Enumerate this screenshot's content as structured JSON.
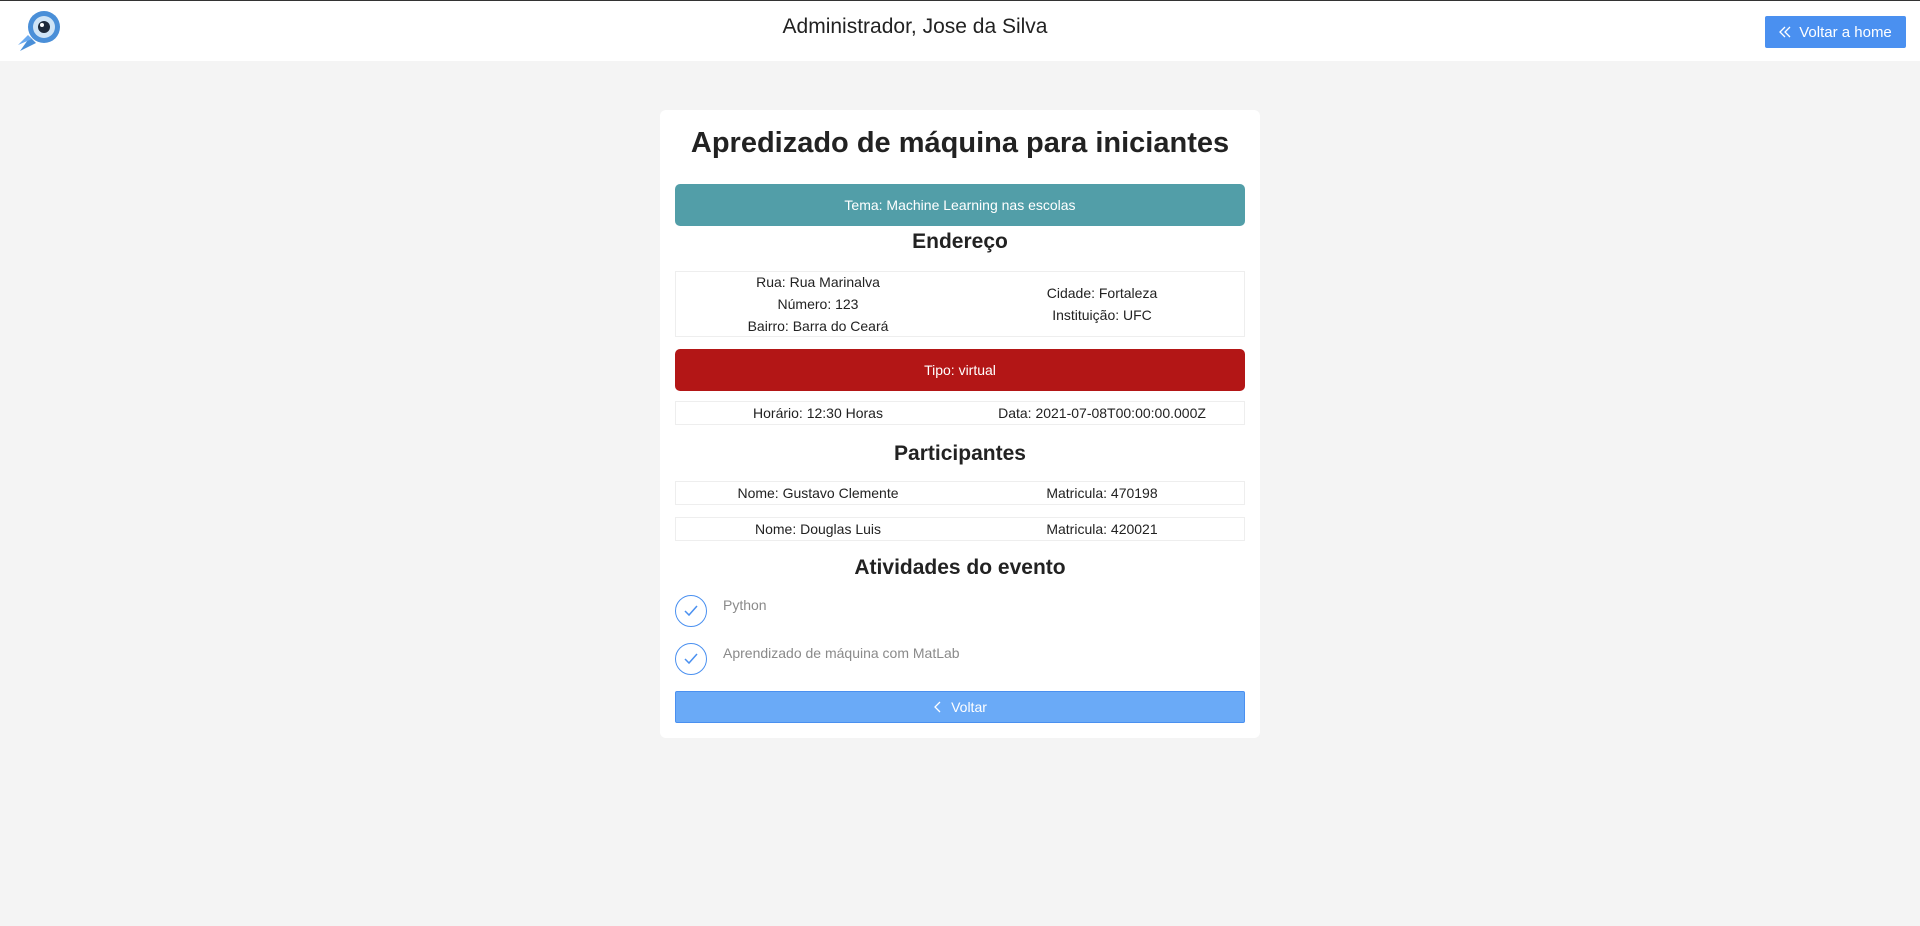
{
  "header": {
    "title": "Administrador, Jose da Silva",
    "home_button": "Voltar a home"
  },
  "event": {
    "title": "Apredizado de máquina para iniciantes",
    "theme": "Tema: Machine Learning nas escolas",
    "address_heading": "Endereço",
    "address": {
      "street": "Rua: Rua Marinalva",
      "number": "Número: 123",
      "district": "Bairro: Barra do Ceará",
      "city": "Cidade: Fortaleza",
      "institution": "Instituição: UFC"
    },
    "type": "Tipo: virtual",
    "time": "Horário: 12:30 Horas",
    "date": "Data: 2021-07-08T00:00:00.000Z",
    "participants_heading": "Participantes",
    "participants": [
      {
        "name": "Nome: Gustavo Clemente",
        "id": "Matricula: 470198"
      },
      {
        "name": "Nome: Douglas Luis",
        "id": "Matricula: 420021"
      }
    ],
    "activities_heading": "Atividades do evento",
    "activities": [
      {
        "label": "Python"
      },
      {
        "label": "Aprendizado de máquina com MatLab"
      }
    ],
    "back_button": "Voltar"
  },
  "colors": {
    "primary": "#4a90f0",
    "theme_bar": "#529ea8",
    "type_bar": "#b31616",
    "back_button": "#6aaaf7"
  },
  "icons": {
    "logo": "rocket-logo",
    "home": "double-chevron-left-icon",
    "activity": "check-circle-icon",
    "back": "chevron-left-icon"
  }
}
